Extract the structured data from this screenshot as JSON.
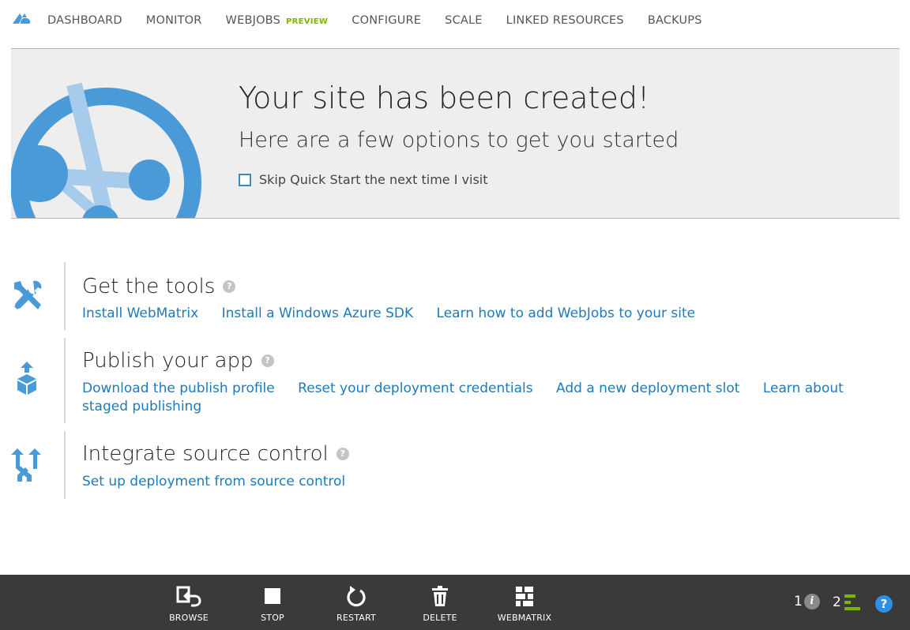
{
  "nav": {
    "logo_icon": "azure-cloud-icon",
    "items": [
      {
        "label": "DASHBOARD"
      },
      {
        "label": "MONITOR"
      },
      {
        "label": "WEBJOBS",
        "badge": "PREVIEW"
      },
      {
        "label": "CONFIGURE"
      },
      {
        "label": "SCALE"
      },
      {
        "label": "LINKED RESOURCES"
      },
      {
        "label": "BACKUPS"
      }
    ]
  },
  "banner": {
    "title": "Your site has been created!",
    "subtitle": "Here are a few options to get you started",
    "skip_label": "Skip Quick Start the next time I visit",
    "skip_checked": false,
    "art_icon": "website-globe-icon"
  },
  "sections": [
    {
      "icon": "tools-icon",
      "title": "Get the tools",
      "links": [
        "Install WebMatrix",
        "Install a Windows Azure SDK",
        "Learn how to add WebJobs to your site"
      ]
    },
    {
      "icon": "publish-box-icon",
      "title": "Publish your app",
      "links": [
        "Download the publish profile",
        "Reset your deployment credentials",
        "Add a new deployment slot",
        "Learn about staged publishing"
      ]
    },
    {
      "icon": "source-control-icon",
      "title": "Integrate source control",
      "links": [
        "Set up deployment from source control"
      ]
    }
  ],
  "toolbar": {
    "buttons": [
      {
        "label": "BROWSE",
        "icon": "browse-icon"
      },
      {
        "label": "STOP",
        "icon": "stop-icon"
      },
      {
        "label": "RESTART",
        "icon": "restart-icon"
      },
      {
        "label": "DELETE",
        "icon": "trash-icon"
      },
      {
        "label": "WEBMATRIX",
        "icon": "webmatrix-icon"
      }
    ],
    "info_count": "1",
    "info_glyph": "i",
    "progress_count": "2",
    "help_glyph": "?"
  },
  "colors": {
    "accent_blue": "#4a9ad8",
    "link_blue": "#1e7ab8",
    "preview_green": "#7ab800",
    "toolbar_bg": "#3a3a3a"
  }
}
